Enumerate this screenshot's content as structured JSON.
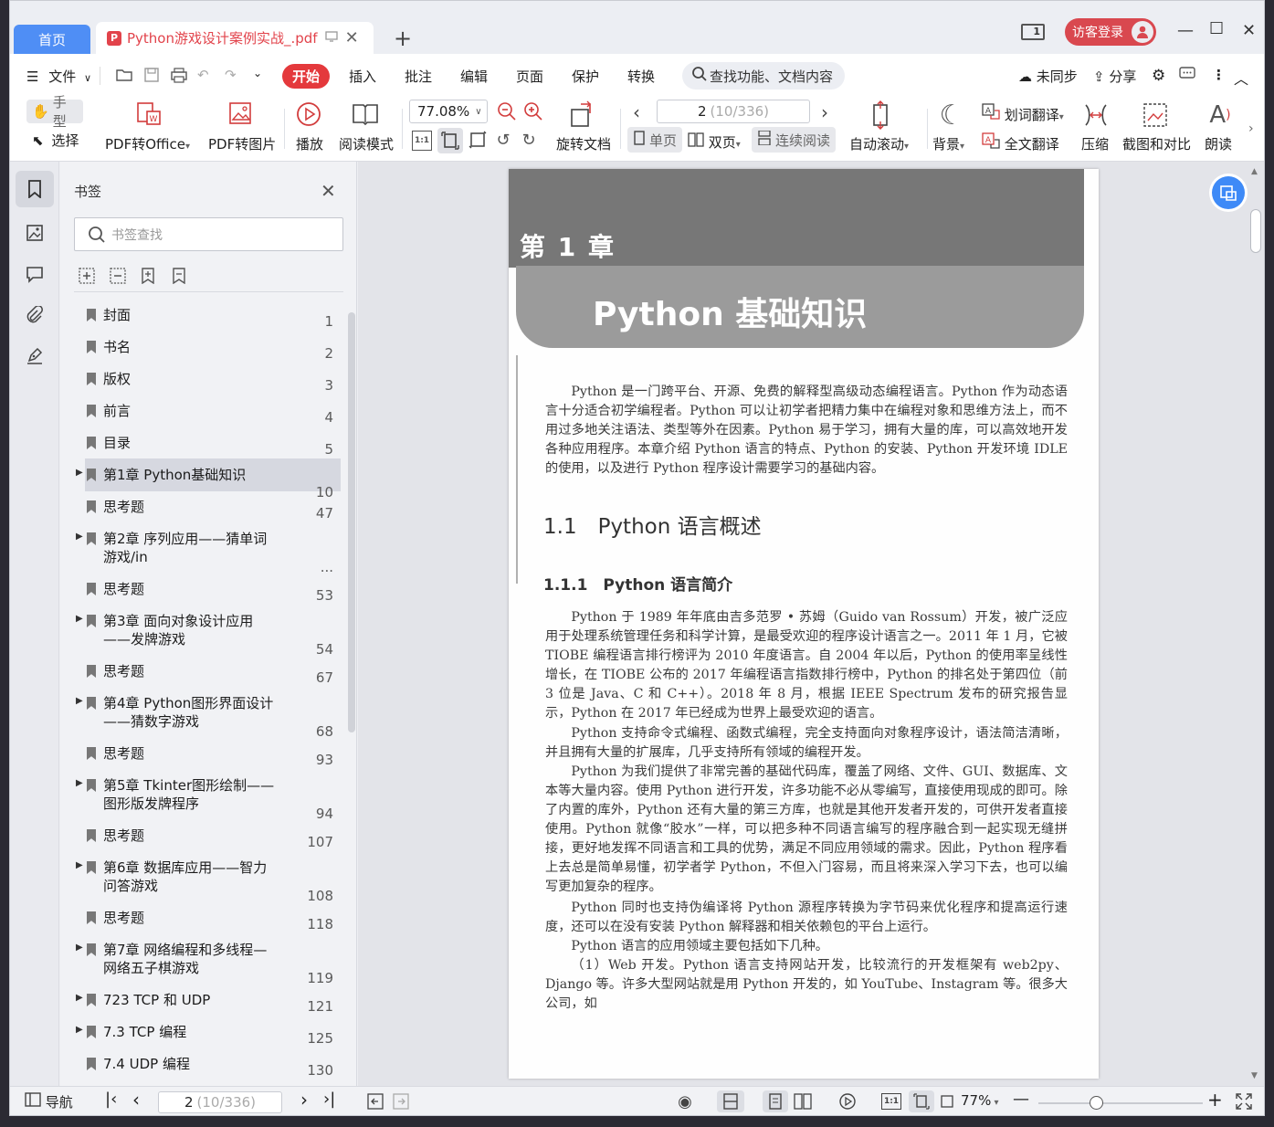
{
  "titlebar": {
    "home_tab": "首页",
    "doc_tab": "Python游戏设计案例实战_.pdf",
    "pdf_badge": "P",
    "login": "访客登录",
    "reader_num": "1"
  },
  "menu": {
    "file": "文件",
    "items": [
      "开始",
      "插入",
      "批注",
      "编辑",
      "页面",
      "保护",
      "转换"
    ],
    "search": "查找功能、文档内容",
    "sync": "未同步",
    "share": "分享"
  },
  "toolbar": {
    "hand": "手型",
    "select": "选择",
    "pdf_office": "PDF转Office",
    "pdf_image": "PDF转图片",
    "play": "播放",
    "read_mode": "阅读模式",
    "zoom": "77.08%",
    "rotate": "旋转文档",
    "page_current": "2",
    "page_total": "(10/336)",
    "single": "单页",
    "double": "双页",
    "continuous": "连续阅读",
    "auto_scroll": "自动滚动",
    "background": "背景",
    "word_translate": "划词翻译",
    "full_translate": "全文翻译",
    "compress": "压缩",
    "screenshot": "截图和对比",
    "read_aloud": "朗读"
  },
  "bookmarks": {
    "title": "书签",
    "search_placeholder": "书签查找",
    "items": [
      {
        "label": "封面",
        "page": "1"
      },
      {
        "label": "书名",
        "page": "2"
      },
      {
        "label": "版权",
        "page": "3"
      },
      {
        "label": "前言",
        "page": "4"
      },
      {
        "label": "目录",
        "page": "5"
      },
      {
        "label": "第1章 Python基础知识",
        "page": "10"
      },
      {
        "label": "思考题",
        "page": "47"
      },
      {
        "label": "第2章 序列应用——猜单词游戏/in",
        "page": "..."
      },
      {
        "label": "思考题",
        "page": "53"
      },
      {
        "label": "第3章 面向对象设计应用——发牌游戏",
        "page": "54"
      },
      {
        "label": "思考题",
        "page": "67"
      },
      {
        "label": "第4章 Python图形界面设计——猜数字游戏",
        "page": "68"
      },
      {
        "label": "思考题",
        "page": "93"
      },
      {
        "label": "第5章 Tkinter图形绘制——图形版发牌程序",
        "page": "94"
      },
      {
        "label": "思考题",
        "page": "107"
      },
      {
        "label": "第6章 数据库应用——智力问答游戏",
        "page": "108"
      },
      {
        "label": "思考题",
        "page": "118"
      },
      {
        "label": "第7章 网络编程和多线程—网络五子棋游戏",
        "page": "119"
      },
      {
        "label": "723 TCP 和 UDP",
        "page": "121"
      },
      {
        "label": "7.3 TCP 编程",
        "page": "125"
      },
      {
        "label": "7.4 UDP 编程",
        "page": "130"
      }
    ]
  },
  "page": {
    "chapter_num": "第 1 章",
    "chapter_title": "Python 基础知识",
    "intro": "Python 是一门跨平台、开源、免费的解释型高级动态编程语言。Python 作为动态语言十分适合初学编程者。Python 可以让初学者把精力集中在编程对象和思维方法上，而不用过多地关注语法、类型等外在因素。Python 易于学习，拥有大量的库，可以高效地开发各种应用程序。本章介绍 Python 语言的特点、Python 的安装、Python 开发环境 IDLE 的使用，以及进行 Python 程序设计需要学习的基础内容。",
    "h1": "1.1　Python 语言概述",
    "h2": "1.1.1　Python 语言简介",
    "p1": "Python 于 1989 年年底由吉多范罗 • 苏姆（Guido van Rossum）开发，被广泛应用于处理系统管理任务和科学计算，是最受欢迎的程序设计语言之一。2011 年 1 月，它被 TIOBE 编程语言排行榜评为 2010 年度语言。自 2004 年以后，Python 的使用率呈线性增长，在 TIOBE 公布的 2017 年编程语言指数排行榜中，Python 的排名处于第四位（前 3 位是 Java、C 和 C++）。2018 年 8 月，根据 IEEE Spectrum 发布的研究报告显示，Python 在 2017 年已经成为世界上最受欢迎的语言。",
    "p2": "Python 支持命令式编程、函数式编程，完全支持面向对象程序设计，语法简洁清晰，并且拥有大量的扩展库，几乎支持所有领域的编程开发。",
    "p3": "Python 为我们提供了非常完善的基础代码库，覆盖了网络、文件、GUI、数据库、文本等大量内容。使用 Python 进行开发，许多功能不必从零编写，直接使用现成的即可。除了内置的库外，Python 还有大量的第三方库，也就是其他开发者开发的，可供开发者直接使用。Python 就像“胶水”一样，可以把多种不同语言编写的程序融合到一起实现无缝拼接，更好地发挥不同语言和工具的优势，满足不同应用领域的需求。因此，Python 程序看上去总是简单易懂，初学者学 Python，不但入门容易，而且将来深入学习下去，也可以编写更加复杂的程序。",
    "p4": "Python 同时也支持伪编译将 Python 源程序转换为字节码来优化程序和提高运行速度，还可以在没有安装 Python 解释器和相关依赖包的平台上运行。",
    "p5": "Python 语言的应用领域主要包括如下几种。",
    "p6": "（1）Web 开发。Python 语言支持网站开发，比较流行的开发框架有 web2py、Django 等。许多大型网站就是用 Python 开发的，如 YouTube、Instagram 等。很多大公司，如"
  },
  "status": {
    "nav": "导航",
    "page_current": "2",
    "page_total": "(10/336)",
    "zoom": "77%"
  },
  "colors": {
    "accent": "#e4393c",
    "home_tab": "#4f8ef5",
    "float": "#3e8af7"
  }
}
